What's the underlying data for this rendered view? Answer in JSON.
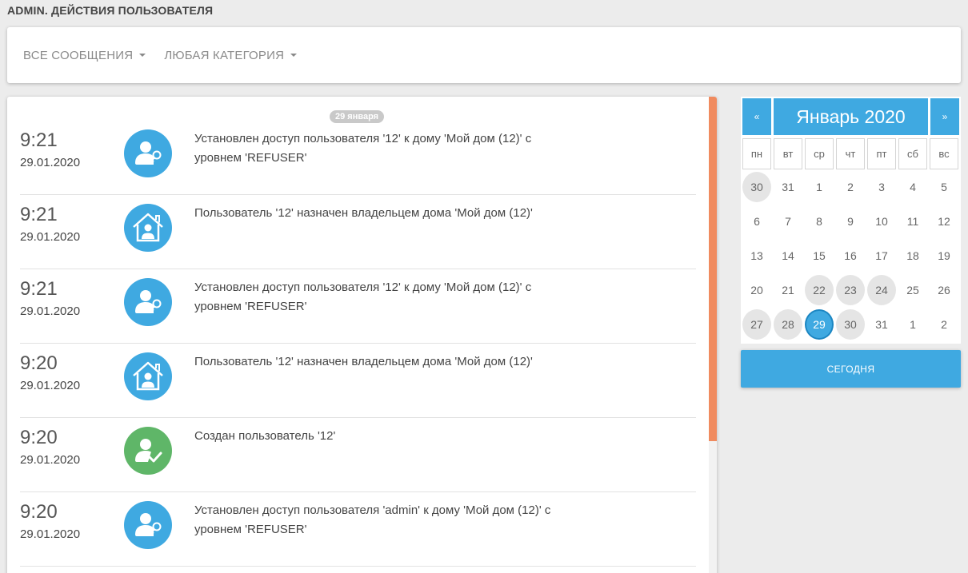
{
  "page_title": "ADMIN. ДЕЙСТВИЯ ПОЛЬЗОВАТЕЛЯ",
  "filters": {
    "messages": "ВСЕ СООБЩЕНИЯ",
    "category": "ЛЮБАЯ КАТЕГОРИЯ"
  },
  "feed": {
    "date_badge": "29 января",
    "entries": [
      {
        "time": "9:21",
        "date": "29.01.2020",
        "icon": "user-key-icon",
        "text": "Установлен доступ пользователя '12' к дому 'Мой дом (12)' с уровнем 'REFUSER'"
      },
      {
        "time": "9:21",
        "date": "29.01.2020",
        "icon": "house-user-icon",
        "text": "Пользователь '12' назначен владельцем дома 'Мой дом (12)'"
      },
      {
        "time": "9:21",
        "date": "29.01.2020",
        "icon": "user-key-icon",
        "text": "Установлен доступ пользователя '12' к дому 'Мой дом (12)' с уровнем 'REFUSER'"
      },
      {
        "time": "9:20",
        "date": "29.01.2020",
        "icon": "house-user-icon",
        "text": "Пользователь '12' назначен владельцем дома 'Мой дом (12)'"
      },
      {
        "time": "9:20",
        "date": "29.01.2020",
        "icon": "user-check-icon",
        "text": "Создан пользователь '12'"
      },
      {
        "time": "9:20",
        "date": "29.01.2020",
        "icon": "user-key-icon",
        "text": "Установлен доступ пользователя 'admin' к дому 'Мой дом (12)' с уровнем 'REFUSER'"
      }
    ]
  },
  "colors": {
    "accent_blue": "#3fa9e1",
    "success_green": "#5fb668",
    "scroll_orange": "#f08b5f"
  },
  "calendar": {
    "prev": "«",
    "next": "»",
    "title": "Январь 2020",
    "weekdays": [
      "пн",
      "вт",
      "ср",
      "чт",
      "пт",
      "сб",
      "вс"
    ],
    "days": [
      "30",
      "31",
      "1",
      "2",
      "3",
      "4",
      "5",
      "6",
      "7",
      "8",
      "9",
      "10",
      "11",
      "12",
      "13",
      "14",
      "15",
      "16",
      "17",
      "18",
      "19",
      "20",
      "21",
      "22",
      "23",
      "24",
      "25",
      "26",
      "27",
      "28",
      "29",
      "30",
      "31",
      "1",
      "2"
    ],
    "highlighted_days": [
      "30",
      "22",
      "23",
      "24",
      "27",
      "28"
    ],
    "selected_day": "29"
  },
  "today_button": "СЕГОДНЯ"
}
